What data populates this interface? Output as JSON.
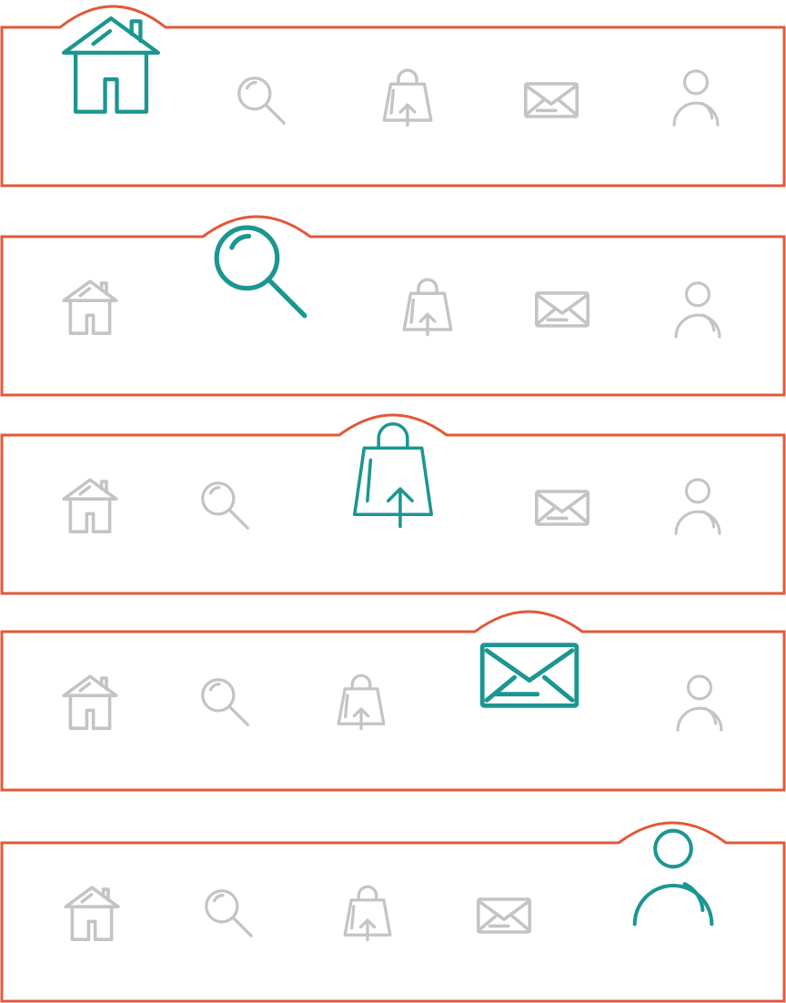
{
  "colors": {
    "frame": "#e2583a",
    "active_icon": "#1c9690",
    "inactive_icon": "#c4c4c4",
    "background": "#ffffff"
  },
  "icon_order": [
    "home-icon",
    "search-icon",
    "shopping-bag-icon",
    "mail-icon",
    "user-icon"
  ],
  "navbars": [
    {
      "variant": "home-active",
      "active_icon": "home-icon"
    },
    {
      "variant": "search-active",
      "active_icon": "search-icon"
    },
    {
      "variant": "bag-active",
      "active_icon": "shopping-bag-icon"
    },
    {
      "variant": "mail-active",
      "active_icon": "mail-icon"
    },
    {
      "variant": "user-active",
      "active_icon": "user-icon"
    }
  ]
}
